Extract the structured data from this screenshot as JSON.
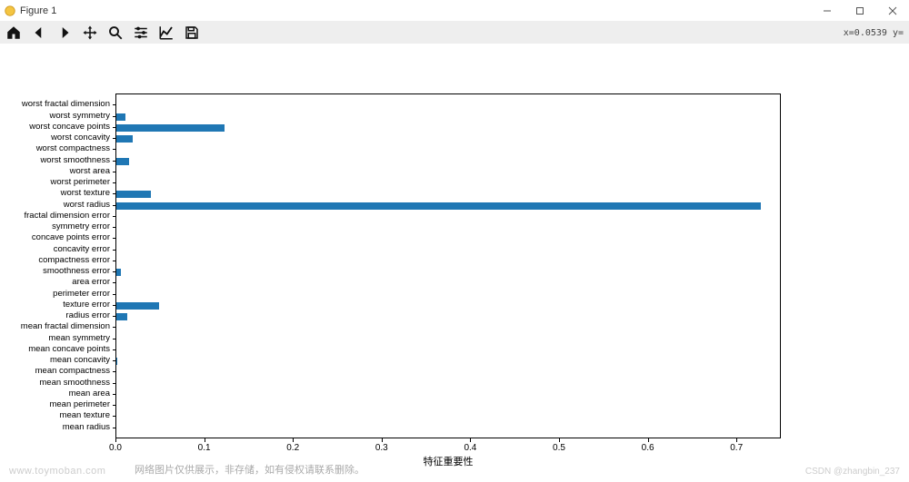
{
  "window": {
    "title": "Figure 1",
    "coords": "x=0.0539 y="
  },
  "toolbar": {
    "home": "Home",
    "back": "Back",
    "forward": "Forward",
    "pan": "Pan",
    "zoom": "Zoom",
    "subplots": "Configure subplots",
    "edit": "Edit axis",
    "save": "Save"
  },
  "footer": {
    "left_watermark": "www.toymoban.com",
    "center_text": "网络图片仅供展示，非存储，如有侵权请联系删除。",
    "right_watermark": "CSDN @zhangbin_237"
  },
  "chart_data": {
    "type": "bar",
    "orientation": "horizontal",
    "xlabel": "特征重要性",
    "ylabel": "",
    "xlim": [
      0.0,
      0.75
    ],
    "xticks": [
      0.0,
      0.1,
      0.2,
      0.3,
      0.4,
      0.5,
      0.6,
      0.7
    ],
    "xtick_labels": [
      "0.0",
      "0.1",
      "0.2",
      "0.3",
      "0.4",
      "0.5",
      "0.6",
      "0.7"
    ],
    "categories": [
      "worst fractal dimension",
      "worst symmetry",
      "worst concave points",
      "worst concavity",
      "worst compactness",
      "worst smoothness",
      "worst area",
      "worst perimeter",
      "worst texture",
      "worst radius",
      "fractal dimension error",
      "symmetry error",
      "concave points error",
      "concavity error",
      "compactness error",
      "smoothness error",
      "area error",
      "perimeter error",
      "texture error",
      "radius error",
      "mean fractal dimension",
      "mean symmetry",
      "mean concave points",
      "mean concavity",
      "mean compactness",
      "mean smoothness",
      "mean area",
      "mean perimeter",
      "mean texture",
      "mean radius"
    ],
    "values": [
      0.0,
      0.01,
      0.122,
      0.018,
      0.0,
      0.014,
      0.0,
      0.0,
      0.039,
      0.726,
      0.0,
      0.0,
      0.0,
      0.0,
      0.0,
      0.005,
      0.0,
      0.0,
      0.048,
      0.012,
      0.0,
      0.0,
      0.0,
      0.001,
      0.0,
      0.0,
      0.0,
      0.0,
      0.0,
      0.0
    ]
  }
}
